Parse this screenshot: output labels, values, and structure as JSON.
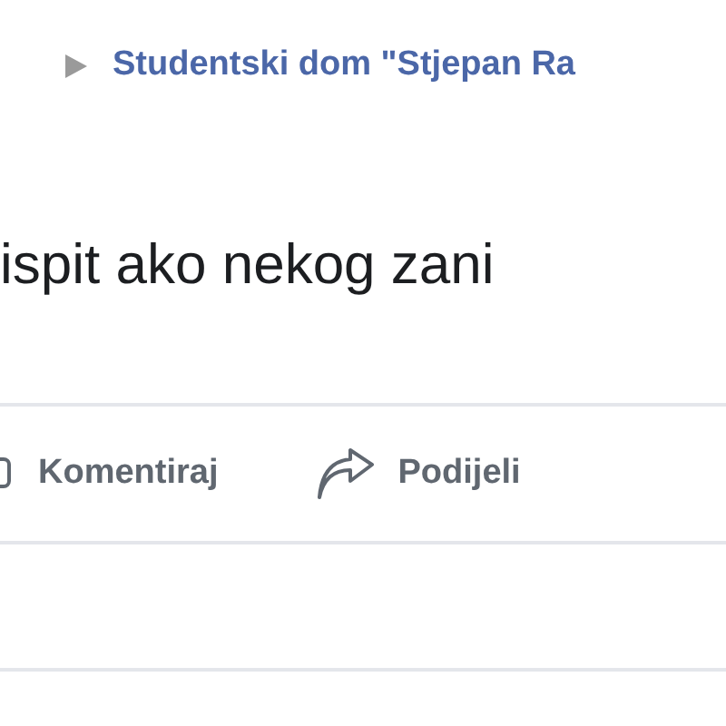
{
  "header": {
    "destination": "Studentski dom \"Stjepan Ra"
  },
  "post": {
    "text": "ispit ako nekog zani"
  },
  "actions": [
    {
      "kind": "comment",
      "label": "Komentiraj"
    },
    {
      "kind": "share",
      "label": "Podijeli"
    }
  ]
}
